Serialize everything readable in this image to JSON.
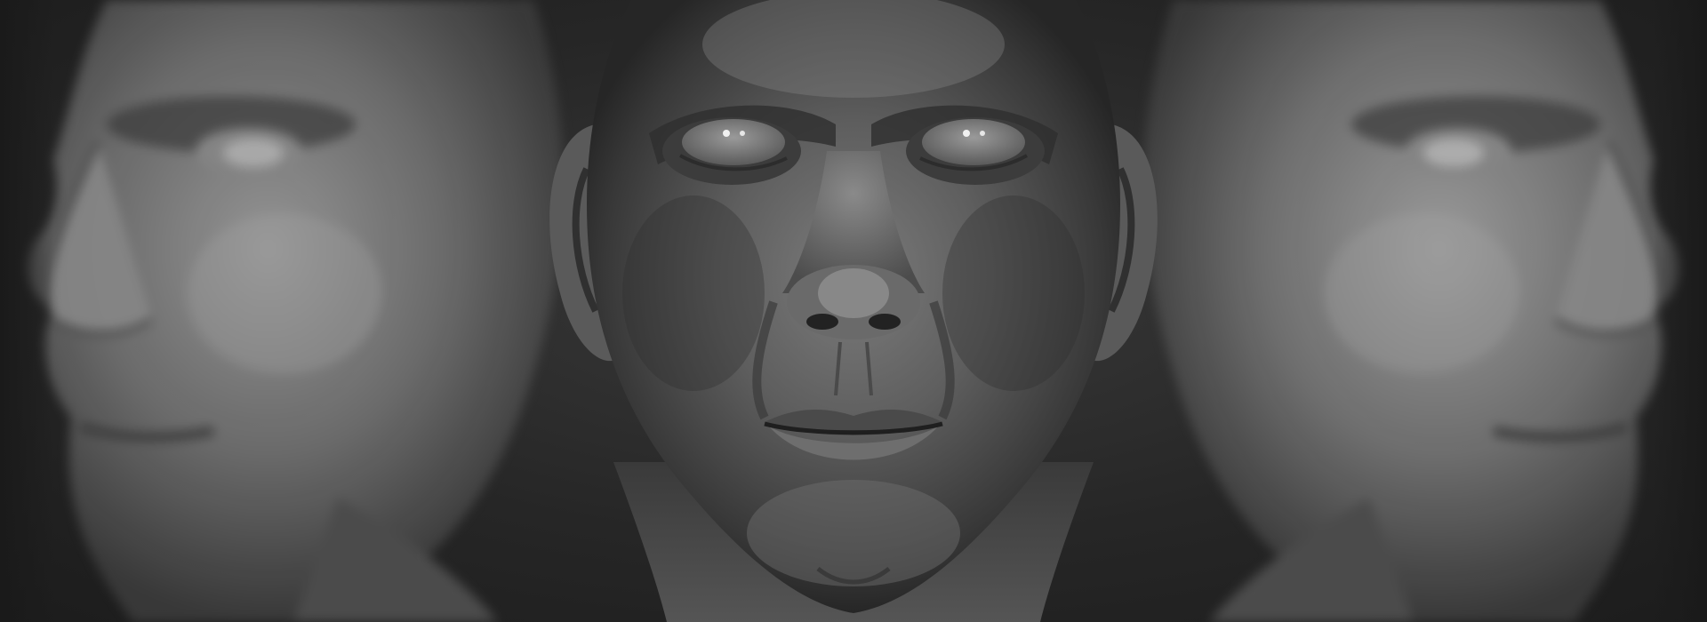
{
  "scene": {
    "subject": "sculpted-male-head-render",
    "views": [
      "left-three-quarter",
      "front",
      "right-three-quarter"
    ]
  }
}
